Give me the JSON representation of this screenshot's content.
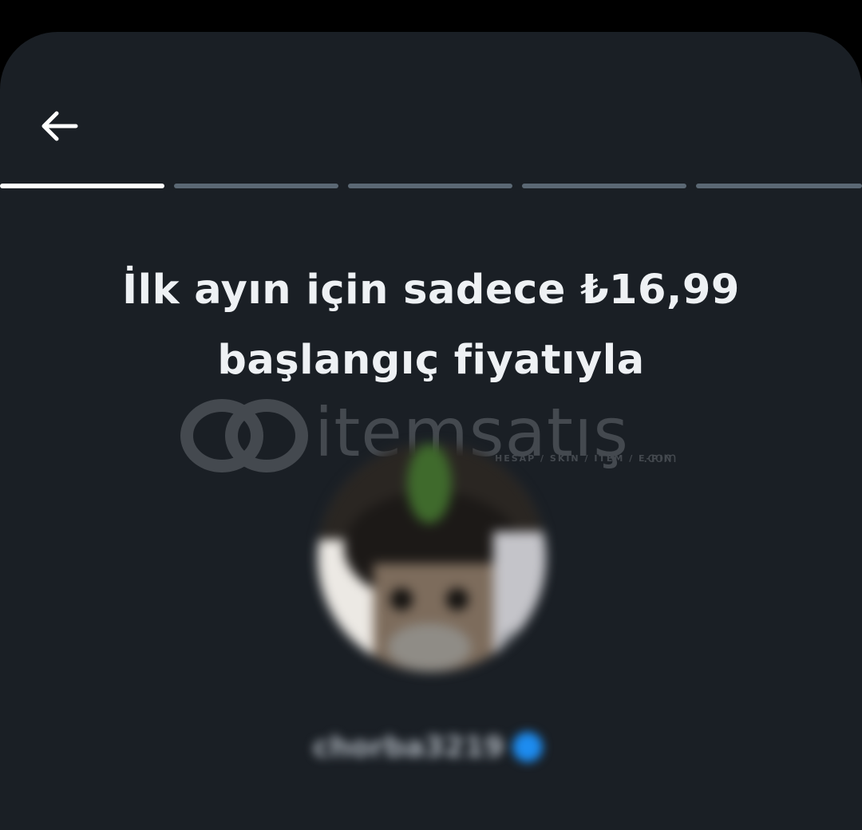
{
  "header": {
    "back_icon": "arrow-left-icon"
  },
  "progress": {
    "total_steps": 5,
    "current_step": 1
  },
  "headline": {
    "line1": "İlk ayın için sadece ₺16,99",
    "line2": "başlangıç fiyatıyla"
  },
  "watermark": {
    "brand": "itemsatış",
    "tagline": "HESAP / SKIN / ITEM / E-PIN",
    "domain": ".com"
  },
  "profile": {
    "username": "chorba3219",
    "verified_icon": "verified-badge-icon"
  },
  "colors": {
    "background": "#1a1f25",
    "progress_active": "#ffffff",
    "progress_inactive": "#5b6874",
    "text": "#eef1f4",
    "verified": "#1d8cf0"
  }
}
